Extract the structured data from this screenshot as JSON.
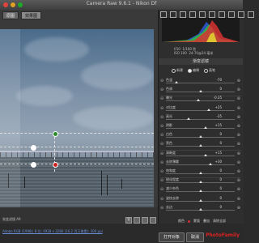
{
  "window": {
    "title": "Camera Raw 9.6.1 - Nikon Df"
  },
  "toolbar_tabs": [
    "原图",
    "效果图"
  ],
  "image": {
    "filter_label": "渐变滤镜 A9",
    "file_info": "Adobe RGB (1998); 8 位; 4928 x 3280 (16.2 百万像素); 300 ppi"
  },
  "exif": {
    "aperture": "f/10",
    "shutter": "1/160 秒",
    "iso": "ISO 100",
    "lens": "24-70@24 毫米"
  },
  "panel": {
    "title": "渐变滤镜",
    "modes": [
      {
        "label": "新建",
        "selected": false
      },
      {
        "label": "编辑",
        "selected": true
      },
      {
        "label": "画笔",
        "selected": false
      }
    ],
    "sliders": [
      {
        "label": "色温",
        "value": "-70"
      },
      {
        "label": "色调",
        "value": "0"
      },
      {
        "label": "曝光",
        "value": "-0.35"
      },
      {
        "label": "对比度",
        "value": "+25"
      },
      {
        "label": "高光",
        "value": "-35"
      },
      {
        "label": "阴影",
        "value": "+15"
      },
      {
        "label": "白色",
        "value": "0"
      },
      {
        "label": "黑色",
        "value": "0"
      },
      {
        "label": "清晰度",
        "value": "+15"
      },
      {
        "label": "去除薄雾",
        "value": "+30"
      },
      {
        "label": "饱和度",
        "value": "0"
      },
      {
        "label": "锐化程度",
        "value": "0"
      },
      {
        "label": "减少杂色",
        "value": "0"
      },
      {
        "label": "波纹去除",
        "value": "0"
      },
      {
        "label": "去边",
        "value": "0"
      }
    ],
    "color_label": "颜色",
    "mask_label": "蒙版",
    "overlay_label": "叠加",
    "clear_label": "清除全部"
  },
  "buttons": {
    "open": "打开对象",
    "cancel": "取消"
  },
  "logo": {
    "text": "Photo",
    "accent": "Family"
  },
  "colors": {
    "accent": "#cc2222",
    "link": "#6a8fd6"
  }
}
